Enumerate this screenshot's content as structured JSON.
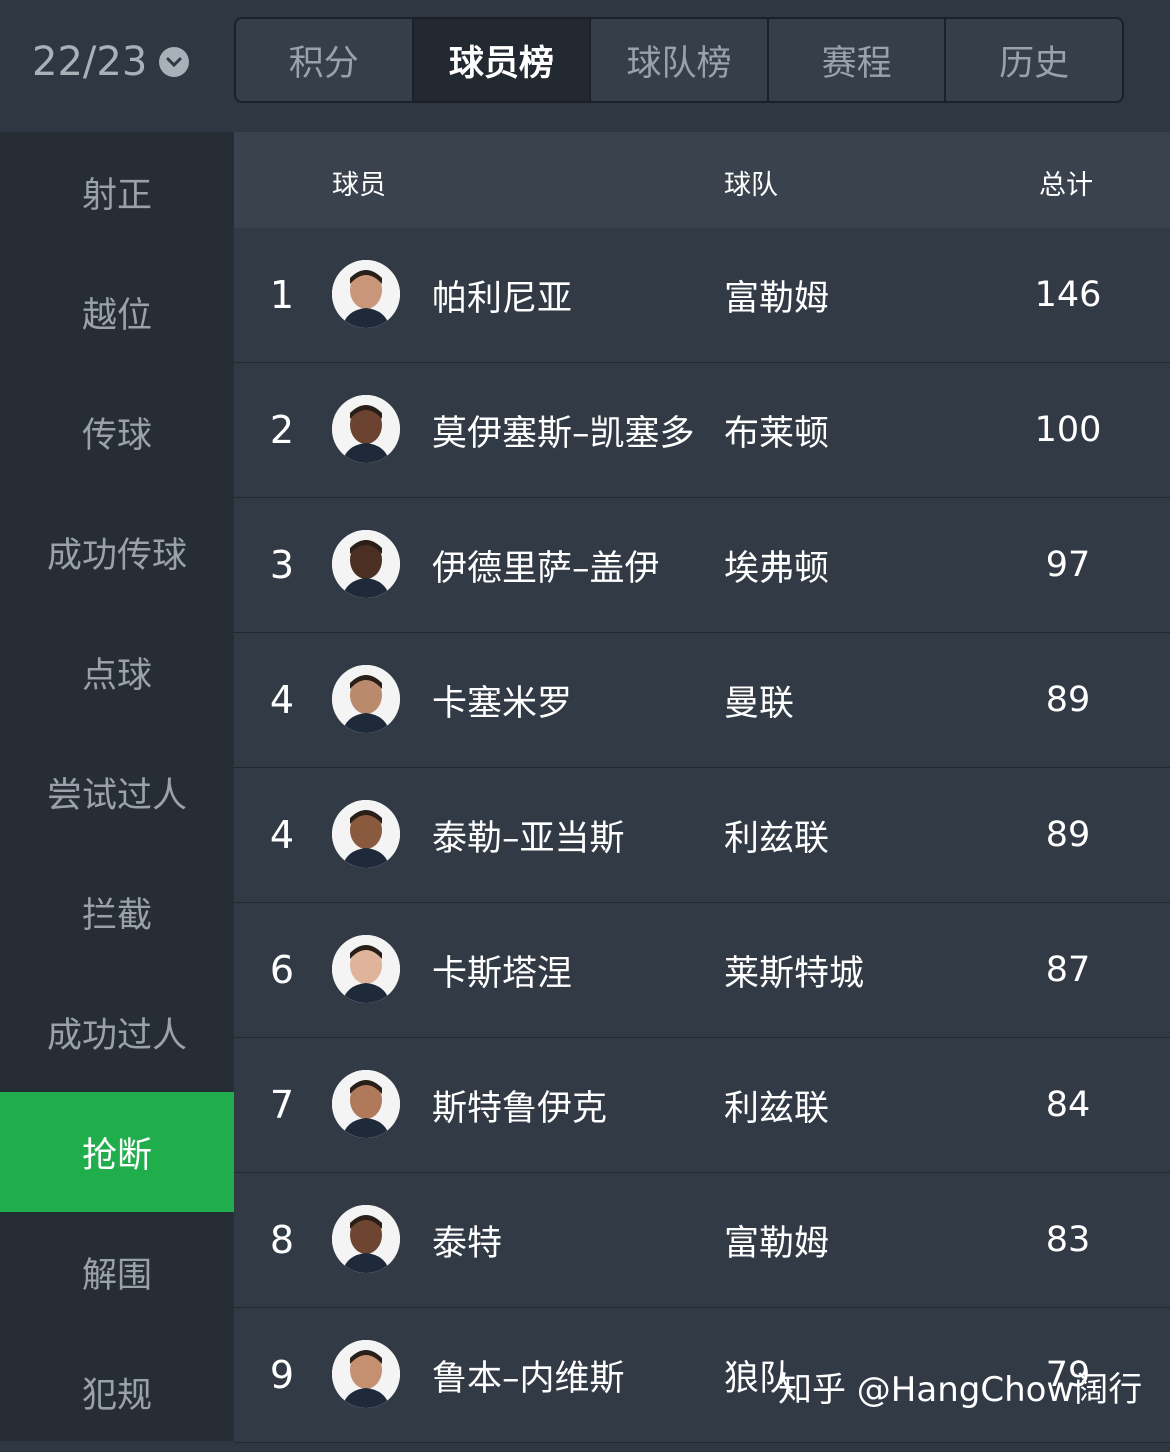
{
  "season": {
    "label": "22/23",
    "icon": "chevron-down-icon"
  },
  "tabs": [
    {
      "label": "积分",
      "active": false
    },
    {
      "label": "球员榜",
      "active": true
    },
    {
      "label": "球队榜",
      "active": false
    },
    {
      "label": "赛程",
      "active": false
    },
    {
      "label": "历史",
      "active": false
    }
  ],
  "sidebar": {
    "items": [
      {
        "label": "射正"
      },
      {
        "label": "越位"
      },
      {
        "label": "传球"
      },
      {
        "label": "成功传球"
      },
      {
        "label": "点球"
      },
      {
        "label": "尝试过人"
      },
      {
        "label": "拦截"
      },
      {
        "label": "成功过人"
      },
      {
        "label": "抢断",
        "active": true
      },
      {
        "label": "解围"
      },
      {
        "label": "犯规"
      }
    ]
  },
  "table": {
    "headers": {
      "player": "球员",
      "team": "球队",
      "total": "总计"
    },
    "rows": [
      {
        "rank": "1",
        "player": "帕利尼亚",
        "team": "富勒姆",
        "total": "146"
      },
      {
        "rank": "2",
        "player": "莫伊塞斯–凯塞多",
        "team": "布莱顿",
        "total": "100"
      },
      {
        "rank": "3",
        "player": "伊德里萨–盖伊",
        "team": "埃弗顿",
        "total": "97"
      },
      {
        "rank": "4",
        "player": "卡塞米罗",
        "team": "曼联",
        "total": "89"
      },
      {
        "rank": "4",
        "player": "泰勒–亚当斯",
        "team": "利兹联",
        "total": "89"
      },
      {
        "rank": "6",
        "player": "卡斯塔涅",
        "team": "莱斯特城",
        "total": "87"
      },
      {
        "rank": "7",
        "player": "斯特鲁伊克",
        "team": "利兹联",
        "total": "84"
      },
      {
        "rank": "8",
        "player": "泰特",
        "team": "富勒姆",
        "total": "83"
      },
      {
        "rank": "9",
        "player": "鲁本–内维斯",
        "team": "狼队",
        "total": "79"
      }
    ]
  },
  "credit": "知乎 @HangChow阔行",
  "colors": {
    "accent": "#1fae4b",
    "bg": "#323a45",
    "sidebar_bg": "#262d35"
  }
}
